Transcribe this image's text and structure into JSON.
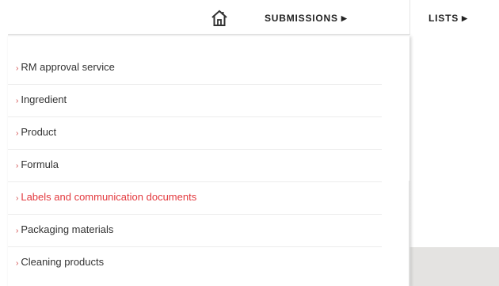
{
  "nav": {
    "home_icon": "home-icon",
    "submissions_label": "SUBMISSIONS",
    "lists_label": "LISTS",
    "arrow_glyph": "▶"
  },
  "menu": {
    "bullet": "›",
    "items": [
      {
        "label": "RM approval service",
        "active": false
      },
      {
        "label": "Ingredient",
        "active": false
      },
      {
        "label": "Product",
        "active": false
      },
      {
        "label": "Formula",
        "active": false
      },
      {
        "label": "Labels and communication documents",
        "active": true
      },
      {
        "label": "Packaging materials",
        "active": false
      },
      {
        "label": "Cleaning products",
        "active": false
      }
    ]
  },
  "colors": {
    "active_text": "#e3393e",
    "text": "#333333",
    "bullet": "#d14a4a",
    "background_band": "#e4e3e1"
  }
}
